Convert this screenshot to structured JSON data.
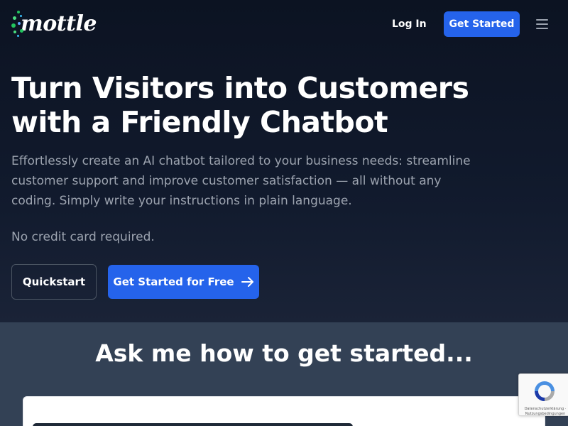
{
  "header": {
    "logo_text": "mottle",
    "login_label": "Log In",
    "cta_label": "Get Started",
    "menu_icon": "hamburger-menu-icon"
  },
  "hero": {
    "headline": "Turn Visitors into Customers with a Friendly Chatbot",
    "subtext": "Effortlessly create an AI chatbot tailored to your business needs: streamline customer support and improve customer satisfaction — all without any coding. Simply write your instructions in plain language.",
    "note": "No credit card required.",
    "quickstart_label": "Quickstart",
    "free_label": "Get Started for Free",
    "arrow_icon": "arrow-right-icon"
  },
  "section2": {
    "title": "Ask me how to get started..."
  },
  "recaptcha": {
    "text": "Datenschutzerklärung · Nutzungsbedingungen"
  },
  "colors": {
    "background": "#0f172a",
    "accent": "#2563eb",
    "section2_bg": "#334155",
    "muted_text": "#9ca3af"
  }
}
